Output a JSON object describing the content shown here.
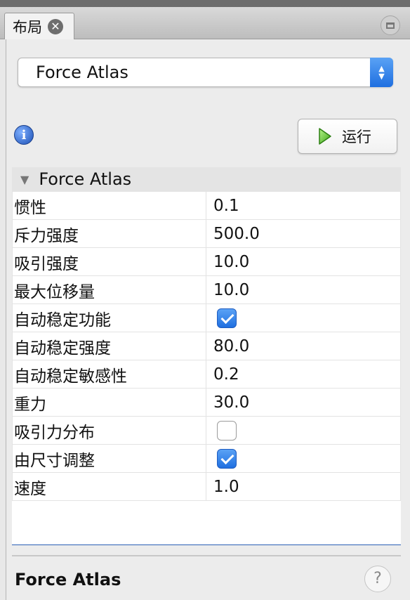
{
  "tab": {
    "label": "布局"
  },
  "algorithm_select": {
    "value": "Force Atlas"
  },
  "run_button": {
    "label": "运行"
  },
  "properties": {
    "section_title": "Force Atlas",
    "rows": [
      {
        "name": "惯性",
        "value": "0.1"
      },
      {
        "name": "斥力强度",
        "value": "500.0"
      },
      {
        "name": "吸引强度",
        "value": "10.0"
      },
      {
        "name": "最大位移量",
        "value": "10.0"
      },
      {
        "name": "自动稳定功能",
        "checked": true
      },
      {
        "name": "自动稳定强度",
        "value": "80.0"
      },
      {
        "name": "自动稳定敏感性",
        "value": "0.2"
      },
      {
        "name": "重力",
        "value": "30.0"
      },
      {
        "name": "吸引力分布",
        "checked": false
      },
      {
        "name": "由尺寸调整",
        "checked": true
      },
      {
        "name": "速度",
        "value": "1.0"
      }
    ]
  },
  "footer": {
    "title": "Force Atlas",
    "help_symbol": "?"
  },
  "colors": {
    "accent": "#2a7ae8",
    "selection_line": "#2a5fb5"
  }
}
